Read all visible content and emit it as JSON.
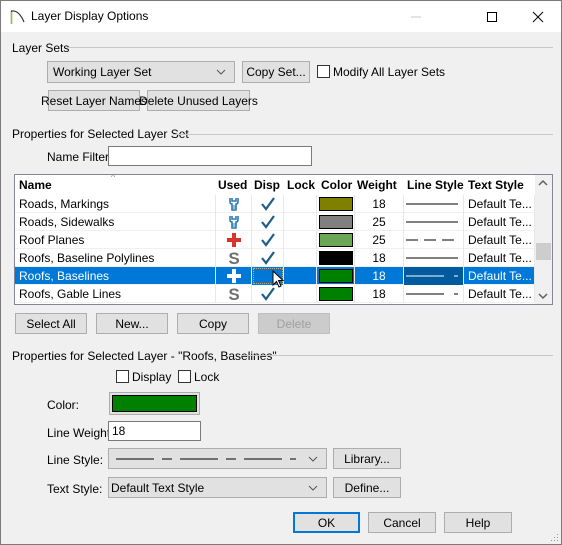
{
  "window": {
    "title": "Layer Display Options",
    "controls": {
      "minimize": "minimize-icon",
      "maximize": "maximize-icon",
      "close": "close-icon"
    }
  },
  "layer_sets": {
    "group_label": "Layer Sets",
    "selected_set": "Working Layer Set",
    "copy_set_label": "Copy Set...",
    "modify_all_label": "Modify All Layer Sets",
    "modify_all_checked": false,
    "reset_names_label": "Reset Layer Names",
    "delete_unused_label": "Delete Unused Layers"
  },
  "set_properties": {
    "group_label": "Properties for Selected Layer Set",
    "name_filter_label": "Name Filter:",
    "name_filter_value": "",
    "columns": [
      "Name",
      "Used",
      "Disp",
      "Lock",
      "Color",
      "Weight",
      "Line Style",
      "Text Style"
    ],
    "sort_column": "Name",
    "rows": [
      {
        "name": "Roads, Markings",
        "used": "wrench",
        "disp": true,
        "lock": false,
        "color": "#808000",
        "weight": "18",
        "line_style": "solid",
        "text_style": "Default Te...",
        "selected": false
      },
      {
        "name": "Roads, Sidewalks",
        "used": "wrench",
        "disp": true,
        "lock": false,
        "color": "#808080",
        "weight": "25",
        "line_style": "solid",
        "text_style": "Default Te...",
        "selected": false
      },
      {
        "name": "Roof Planes",
        "used": "plus",
        "disp": true,
        "lock": false,
        "color": "#6ca657",
        "weight": "25",
        "line_style": "dashed",
        "text_style": "Default Te...",
        "selected": false
      },
      {
        "name": "Roofs, Baseline Polylines",
        "used": "s",
        "disp": true,
        "lock": false,
        "color": "#000000",
        "weight": "18",
        "line_style": "solid",
        "text_style": "Default Te...",
        "selected": false
      },
      {
        "name": "Roofs, Baselines",
        "used": "plus",
        "disp": false,
        "lock": false,
        "color": "#008000",
        "weight": "18",
        "line_style": "dash-dot",
        "text_style": "Default Te...",
        "selected": true
      },
      {
        "name": "Roofs, Gable Lines",
        "used": "s",
        "disp": true,
        "lock": false,
        "color": "#008000",
        "weight": "18",
        "line_style": "dash-dot",
        "text_style": "Default Te...",
        "selected": false
      }
    ],
    "buttons": {
      "select_all": "Select All",
      "new": "New...",
      "copy": "Copy",
      "delete": "Delete"
    }
  },
  "layer_properties": {
    "group_label": "Properties for Selected Layer - \"Roofs, Baselines\"",
    "display_label": "Display",
    "display_checked": false,
    "lock_label": "Lock",
    "lock_checked": false,
    "color_label": "Color:",
    "color_value": "#008000",
    "line_weight_label": "Line Weight:",
    "line_weight_value": "18",
    "line_style_label": "Line Style:",
    "line_style_value": "dash-dot",
    "library_label": "Library...",
    "text_style_label": "Text Style:",
    "text_style_value": "Default Text Style",
    "define_label": "Define..."
  },
  "footer": {
    "ok": "OK",
    "cancel": "Cancel",
    "help": "Help"
  }
}
